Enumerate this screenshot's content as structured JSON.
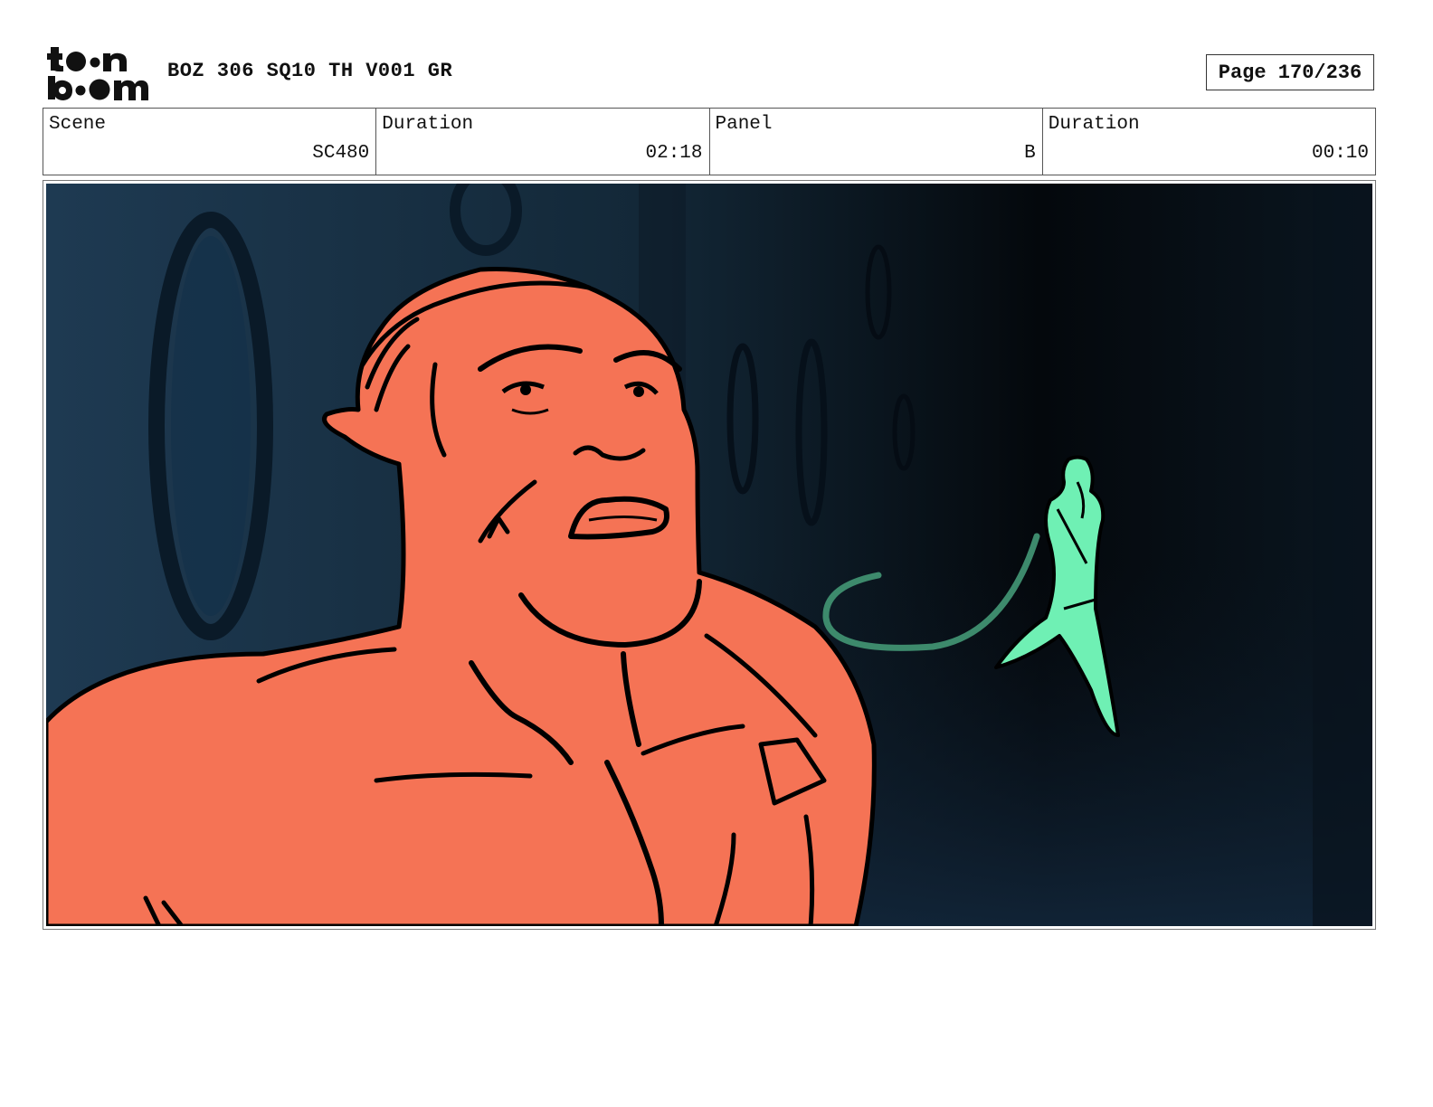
{
  "brand": {
    "logo_text": "toon boom",
    "logo_icon": "toon-boom-logo"
  },
  "header": {
    "title": "BOZ 306 SQ10 TH V001 GR",
    "page": "Page 170/236"
  },
  "info": [
    {
      "label": "Scene",
      "value": "SC480"
    },
    {
      "label": "Duration",
      "value": "02:18"
    },
    {
      "label": "Panel",
      "value": "B"
    },
    {
      "label": "Duration",
      "value": "00:10"
    }
  ],
  "panel": {
    "colors": {
      "background": "#0c1822",
      "character": "#f57355",
      "distant_figure": "#6ff0b4",
      "tail": "#3d8a6c",
      "outline": "#000000"
    }
  }
}
